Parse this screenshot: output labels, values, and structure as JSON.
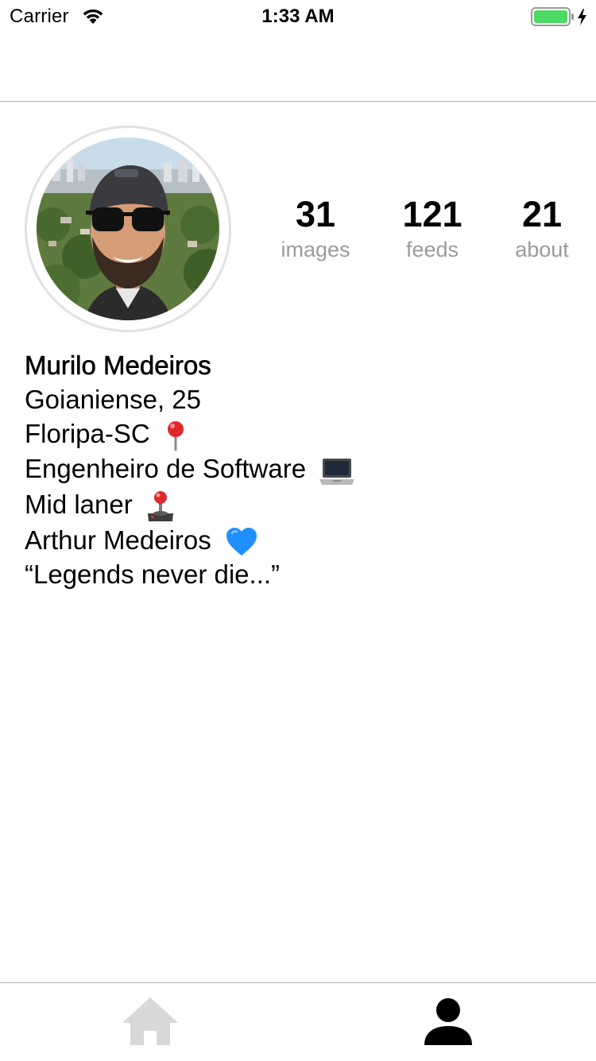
{
  "status_bar": {
    "carrier": "Carrier",
    "time": "1:33 AM",
    "battery_color": "#4cd964"
  },
  "profile": {
    "stats": [
      {
        "value": "31",
        "label": "images"
      },
      {
        "value": "121",
        "label": "feeds"
      },
      {
        "value": "21",
        "label": "about"
      }
    ],
    "name": "Murilo Medeiros",
    "bio_lines": [
      {
        "text": "Goianiense, 25",
        "icon": ""
      },
      {
        "text": "Floripa-SC",
        "icon": "round-pushpin-icon"
      },
      {
        "text": "Engenheiro de Software",
        "icon": "laptop-icon"
      },
      {
        "text": "Mid laner",
        "icon": "joystick-icon"
      },
      {
        "text": "Arthur Medeiros",
        "icon": "blue-heart-icon"
      },
      {
        "text": "“Legends never die...”",
        "icon": ""
      }
    ]
  },
  "tab_bar": {
    "tabs": [
      {
        "icon": "home-icon",
        "active": false,
        "color": "#d8d8d8"
      },
      {
        "icon": "person-icon",
        "active": true,
        "color": "#000000"
      }
    ]
  }
}
